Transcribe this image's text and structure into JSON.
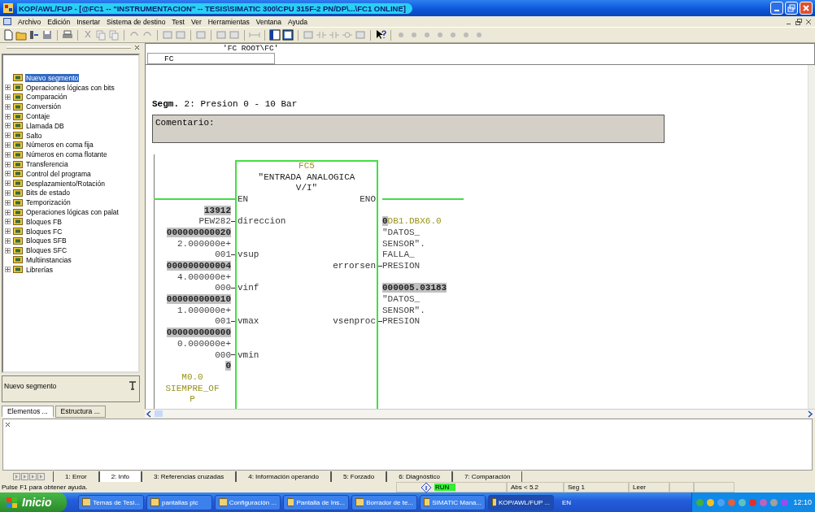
{
  "window": {
    "title": "KOP/AWL/FUP  - [@FC1 -- \"INSTRUMENTACION\" -- TESIS\\SIMATIC 300\\CPU 315F-2 PN/DP\\...\\FC1  ONLINE]"
  },
  "menu": [
    "Archivo",
    "Edición",
    "Insertar",
    "Sistema de destino",
    "Test",
    "Ver",
    "Herramientas",
    "Ventana",
    "Ayuda"
  ],
  "elements_panel": {
    "items": [
      {
        "label": "Nuevo segmento",
        "expandable": false,
        "selected": true
      },
      {
        "label": "Operaciones lógicas con bits",
        "expandable": true,
        "selected": false
      },
      {
        "label": "Comparación",
        "expandable": true,
        "selected": false
      },
      {
        "label": "Conversión",
        "expandable": true,
        "selected": false
      },
      {
        "label": "Contaje",
        "expandable": true,
        "selected": false
      },
      {
        "label": "Llamada DB",
        "expandable": true,
        "selected": false
      },
      {
        "label": "Salto",
        "expandable": true,
        "selected": false
      },
      {
        "label": "Números en coma fija",
        "expandable": true,
        "selected": false
      },
      {
        "label": "Números en coma flotante",
        "expandable": true,
        "selected": false
      },
      {
        "label": "Transferencia",
        "expandable": true,
        "selected": false
      },
      {
        "label": "Control del programa",
        "expandable": true,
        "selected": false
      },
      {
        "label": "Desplazamiento/Rotación",
        "expandable": true,
        "selected": false
      },
      {
        "label": "Bits de estado",
        "expandable": true,
        "selected": false
      },
      {
        "label": "Temporización",
        "expandable": true,
        "selected": false
      },
      {
        "label": "Operaciones lógicas con palat",
        "expandable": true,
        "selected": false
      },
      {
        "label": "Bloques FB",
        "expandable": true,
        "selected": false
      },
      {
        "label": "Bloques FC",
        "expandable": true,
        "selected": false
      },
      {
        "label": "Bloques SFB",
        "expandable": true,
        "selected": false
      },
      {
        "label": "Bloques SFC",
        "expandable": true,
        "selected": false
      },
      {
        "label": "Multiinstancias",
        "expandable": false,
        "selected": false
      },
      {
        "label": "Librerías",
        "expandable": true,
        "selected": false
      }
    ],
    "info": "Nuevo segmento",
    "tabs": [
      {
        "label": "Elementos ...",
        "selected": true
      },
      {
        "label": "Estructura ...",
        "selected": false
      }
    ]
  },
  "editor": {
    "path": "'FC ROOT\\FC'",
    "block_combo": "FC",
    "segment_title": "**Segm.** 2: Presion 0 - 10 Bar",
    "comment": "Comentario:",
    "block": {
      "number": "FC5",
      "name_lines": [
        "\"ENTRADA ANALOGICA",
        "V/I\""
      ],
      "en": "EN",
      "eno": "ENO",
      "inputs": [
        {
          "pin": "direccion",
          "value": "13912",
          "operand_lines": [
            "PEW282"
          ]
        },
        {
          "pin": "vsup",
          "value": "000000000020",
          "operand_lines": [
            "2.000000e+",
            "001"
          ]
        },
        {
          "pin": "vinf",
          "value": "000000000004",
          "operand_lines": [
            "4.000000e+",
            "000"
          ]
        },
        {
          "pin": "vmax",
          "value": "000000000010",
          "operand_lines": [
            "1.000000e+",
            "001"
          ]
        },
        {
          "pin": "vmin",
          "value": "000000000000",
          "operand_lines": [
            "0.000000e+",
            "000"
          ]
        }
      ],
      "enable_operand": {
        "value": "0",
        "address": "M0.0",
        "symbol_lines": [
          "SIEMPRE_OF",
          "P"
        ]
      },
      "outputs": [
        {
          "pin": "errorsen",
          "value": "0",
          "address": "DB1.DBX6.0",
          "symbol_lines": [
            "\"DATOS_",
            "SENSOR\".",
            "FALLA_",
            "PRESION"
          ]
        },
        {
          "pin": "vsenproc",
          "value": "000005.03183",
          "symbol_lines": [
            "\"DATOS_",
            "SENSOR\".",
            "PRESION"
          ]
        }
      ]
    }
  },
  "output_tabs": [
    {
      "label": "1: Error",
      "selected": false
    },
    {
      "label": "2: Info",
      "selected": true
    },
    {
      "label": "3: Referencias cruzadas",
      "selected": false
    },
    {
      "label": "4: Información operando",
      "selected": false
    },
    {
      "label": "5: Forzado",
      "selected": false
    },
    {
      "label": "6: Diagnóstico",
      "selected": false
    },
    {
      "label": "7: Comparación",
      "selected": false
    }
  ],
  "status_bar": {
    "help": "Pulse F1 para obtener ayuda.",
    "mode": "RUN",
    "position": "Abs < 5.2",
    "segment": "Seg 1",
    "access": "Leer"
  },
  "taskbar": {
    "start": "Inicio",
    "tasks": [
      {
        "label": "Temas de Tesi...",
        "selected": false
      },
      {
        "label": "pantallas plc",
        "selected": false
      },
      {
        "label": "Configuración ...",
        "selected": false
      },
      {
        "label": "Pantalla de Ins...",
        "selected": false
      },
      {
        "label": "Borrador de te...",
        "selected": false
      },
      {
        "label": "SIMATIC Mana...",
        "selected": false
      },
      {
        "label": "KOP/AWL/FUP ...",
        "selected": true
      }
    ],
    "language": "EN",
    "clock": "12:10"
  }
}
